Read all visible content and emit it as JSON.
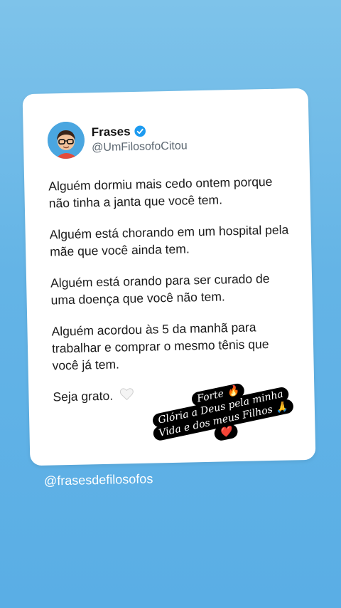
{
  "tweet": {
    "name": "Frases",
    "handle": "@UmFilosofoCitou",
    "paragraphs": [
      "Alguém dormiu mais cedo ontem porque não tinha a janta que você tem.",
      "Alguém está chorando em um hospital pela mãe que você ainda tem.",
      "Alguém está orando para ser curado de uma doença que você não tem.",
      "Alguém acordou às 5 da manhã para trabalhar e comprar o mesmo tênis que você já tem."
    ],
    "closing": "Seja grato."
  },
  "credit": "@frasesdefilosofos",
  "sticker": {
    "line1": "Forte 🔥",
    "line2": "Glória a Deus pela minha",
    "line3": "Vida e dos meus Filhos 🙏",
    "line4": "❤️"
  },
  "colors": {
    "background_top": "#7ec3ea",
    "background_bottom": "#5aaee5",
    "verified": "#1d9bf0"
  }
}
